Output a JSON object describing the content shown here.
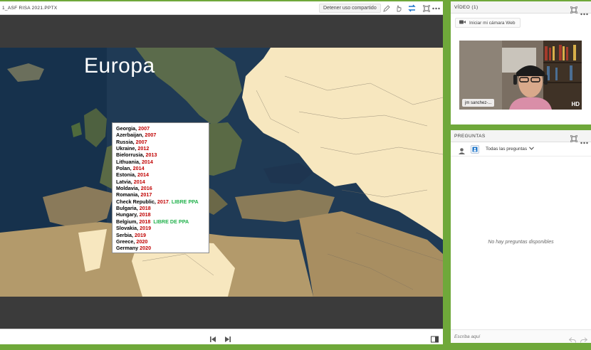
{
  "share_pod": {
    "title": "1_ASF RISA 2021.PPTX",
    "stop_sharing_label": "Detener uso compartido",
    "icons": [
      "pencil-icon",
      "hand-pointer-icon",
      "swap-icon",
      "fullscreen-icon",
      "more-options-icon"
    ],
    "accent_icon_color": "#1a73c8"
  },
  "slide": {
    "title": "Europa",
    "countries": [
      {
        "country": "Georgia, ",
        "year": "2007",
        "note": ""
      },
      {
        "country": "Azerbaijan, ",
        "year": "2007",
        "note": ""
      },
      {
        "country": "Russia, ",
        "year": "2007",
        "note": ""
      },
      {
        "country": "Ukraine, ",
        "year": "2012",
        "note": ""
      },
      {
        "country": "Bielorrusia, ",
        "year": "2013",
        "note": ""
      },
      {
        "country": "Lithuania, ",
        "year": "2014",
        "note": ""
      },
      {
        "country": "Polan, ",
        "year": "2014",
        "note": ""
      },
      {
        "country": "Estonia, ",
        "year": "2014",
        "note": ""
      },
      {
        "country": "Latvia, ",
        "year": "2014",
        "note": ""
      },
      {
        "country": "Moldavia, ",
        "year": "2016",
        "note": ""
      },
      {
        "country": "Romania, ",
        "year": "2017",
        "note": ""
      },
      {
        "country": "Check Republic, ",
        "year": "2017",
        "note": ". LIBRE PPA"
      },
      {
        "country": "Bulgaria, ",
        "year": "2018",
        "note": ""
      },
      {
        "country": "Hungary, ",
        "year": "2018",
        "note": ""
      },
      {
        "country": "Belgium, ",
        "year": "2018",
        "note": "  LIBRE DE PPA"
      },
      {
        "country": "Slovakia, ",
        "year": "2019",
        "note": ""
      },
      {
        "country": "Serbia, ",
        "year": "2019",
        "note": ""
      },
      {
        "country": "Greece, ",
        "year": "2020",
        "note": ""
      },
      {
        "country": "Germany ",
        "year": "2020",
        "note": ""
      }
    ],
    "colors": {
      "year": "#c00000",
      "note": "#22b14c"
    }
  },
  "footer": {
    "prev_icon": "skip-previous-icon",
    "next_icon": "skip-next-icon",
    "layout_icon": "sidebar-toggle-icon"
  },
  "video_pod": {
    "title": "VÍDEO (1)",
    "webcam_button_label": "Iniciar mi cámara Web",
    "participant_name": "jm sanchez-...",
    "hd_label": "HD"
  },
  "questions_pod": {
    "title": "PREGUNTAS",
    "filter_label": "Todas las preguntas",
    "empty_message": "No hay preguntas disponibles",
    "input_placeholder": "Escriba aquí"
  },
  "theme": {
    "frame_green": "#6fa83a",
    "stage_dark": "#3c3c3c"
  }
}
